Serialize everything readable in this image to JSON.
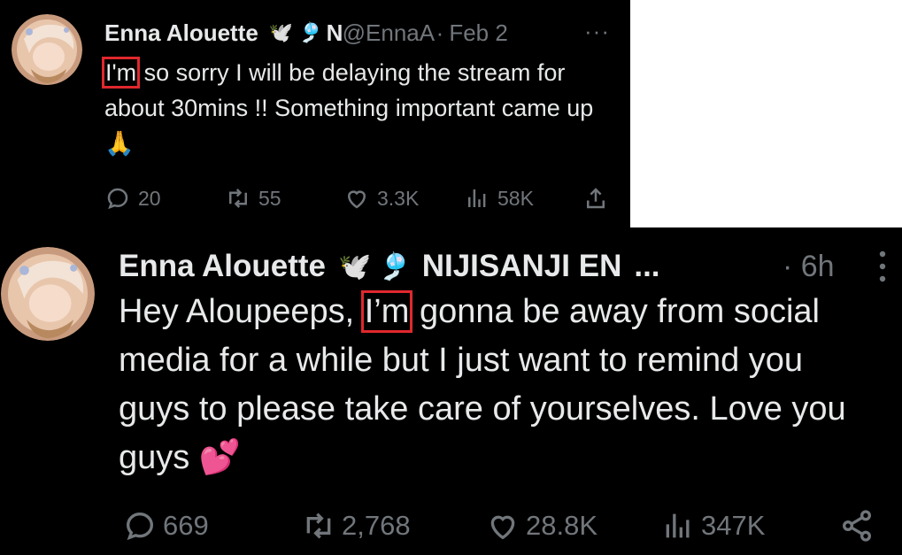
{
  "tweet_small": {
    "author_name": "Enna Alouette",
    "emoji_1": "🕊️",
    "emoji_2": "🎐",
    "truncated_org": "N",
    "handle": "@EnnaA",
    "separator": "·",
    "date": "Feb 2",
    "more": "···",
    "text_highlight": "I'm",
    "text_rest": " so sorry I will be delaying the stream for about 30mins !! Something important came up ",
    "text_emoji": "🙏",
    "replies": "20",
    "reposts": "55",
    "likes": "3.3K",
    "views": "58K"
  },
  "tweet_large": {
    "author_name": "Enna Alouette",
    "emoji_1": "🕊️",
    "emoji_2": "🎐",
    "org": "NIJISANJI EN",
    "ellipsis": "...",
    "time": "· 6h",
    "text_before": "Hey Aloupeeps, ",
    "text_highlight": "I’m",
    "text_after": " gonna be away from social media for a while but I just want to remind you guys to please take care of yourselves. Love you guys ",
    "text_emoji": "💕",
    "replies": "669",
    "reposts": "2,768",
    "likes": "28.8K",
    "views": "347K"
  },
  "colors": {
    "background": "#000000",
    "text": "#e7e9ea",
    "muted": "#71767b",
    "highlight_box": "#e0282e"
  },
  "icons": [
    "reply-icon",
    "repost-icon",
    "like-icon",
    "views-icon",
    "share-icon",
    "more-icon"
  ]
}
